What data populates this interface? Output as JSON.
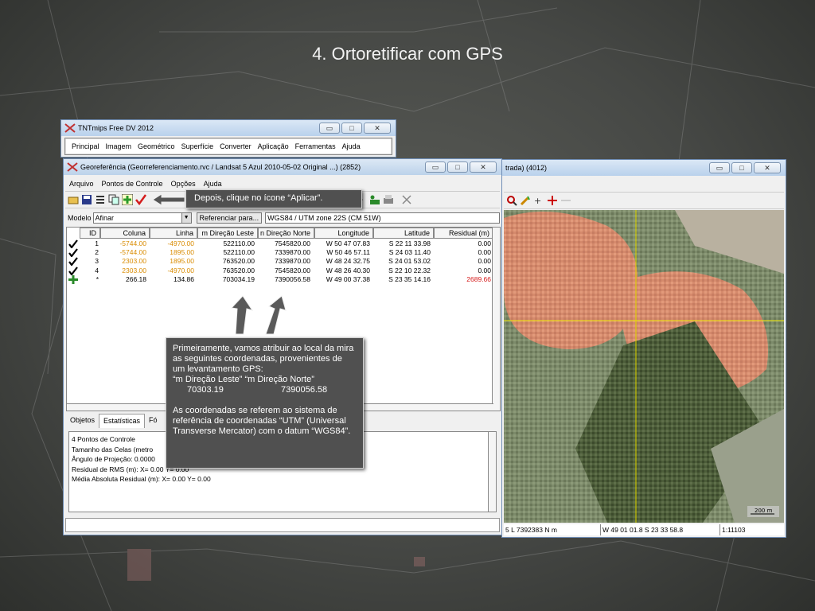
{
  "slide": {
    "title": "4. Ortoretificar com GPS"
  },
  "tnt_window": {
    "title": "TNTmips Free DV 2012",
    "menu": [
      "Principal",
      "Imagem",
      "Geométrico",
      "Superfície",
      "Converter",
      "Aplicação",
      "Ferramentas",
      "Ajuda"
    ]
  },
  "geo_window": {
    "title": "Georeferência (Georreferenciamento.rvc / Landsat 5 Azul 2010-05-02 Original ...) (2852)",
    "menu": [
      "Arquivo",
      "Pontos de Controle",
      "Opções",
      "Ajuda"
    ],
    "model_label": "Modelo",
    "model_value": "Afinar",
    "ref_button": "Referenciar para...",
    "ref_system": "WGS84 / UTM zone 22S (CM 51W)",
    "columns": [
      "ID",
      "Coluna",
      "Linha",
      "m Direção Leste",
      "n Direção Norte",
      "Longitude",
      "Latitude",
      "Residual (m)"
    ],
    "rows": [
      {
        "id": "1",
        "col": "-5744.00",
        "lin": "-4970.00",
        "east": "522110.00",
        "north": "7545820.00",
        "lon": "W 50 47 07.83",
        "lat": "S 22 11 33.98",
        "res": "0.00"
      },
      {
        "id": "2",
        "col": "-5744.00",
        "lin": "1895.00",
        "east": "522110.00",
        "north": "7339870.00",
        "lon": "W 50 46 57.11",
        "lat": "S 24 03 11.40",
        "res": "0.00"
      },
      {
        "id": "3",
        "col": "2303.00",
        "lin": "1895.00",
        "east": "763520.00",
        "north": "7339870.00",
        "lon": "W 48 24 32.75",
        "lat": "S 24 01 53.02",
        "res": "0.00"
      },
      {
        "id": "4",
        "col": "2303.00",
        "lin": "-4970.00",
        "east": "763520.00",
        "north": "7545820.00",
        "lon": "W 48 26 40.30",
        "lat": "S 22 10 22.32",
        "res": "0.00"
      },
      {
        "id": "*",
        "col": "266.18",
        "lin": "134.86",
        "east": "703034.19",
        "north": "7390056.58",
        "lon": "W 49 00 37.38",
        "lat": "S 23 35 14.16",
        "res": "2689.66"
      }
    ],
    "tabs": [
      "Objetos",
      "Estatísticas",
      "Fó"
    ],
    "stats": [
      "4 Pontos de Controle",
      "Tamanho das Celas (metro",
      "Ângulo de Projeção: 0.0000",
      "Residual de RMS (m):  X= 0.00  Y= 0.00",
      "Média Absoluta Residual (m):  X= 0.00  Y= 0.00"
    ]
  },
  "view_window": {
    "title": "trada) (4012)",
    "status_coord": "5 L  7392383 N m",
    "status_geo": "W 49 01 01.8  S 23 33 58.8",
    "status_scale": "1:11103",
    "scalebar": "200 m"
  },
  "callouts": {
    "apply": "Depois, clique no ícone “Aplicar”.",
    "main_p1": "Primeiramente, vamos atribuir ao local da mira as seguintes coordenadas, provenientes de um levantamento GPS:",
    "main_labels": "“m Direção Leste”  “m Direção Norte”",
    "main_east": "70303.19",
    "main_north": "7390056.58",
    "main_p2": "As coordenadas se referem ao sistema de referência de coordenadas “UTM” (Universal Transverse Mercator) com o datum “WGS84”."
  },
  "window_buttons": {
    "min": "▭",
    "max": "□",
    "close": "✕"
  },
  "colors": {
    "accent_orange": "#d98b00",
    "residual_red": "#d61a1a",
    "crosshair": "#e8e000",
    "callout_bg": "#505050"
  }
}
